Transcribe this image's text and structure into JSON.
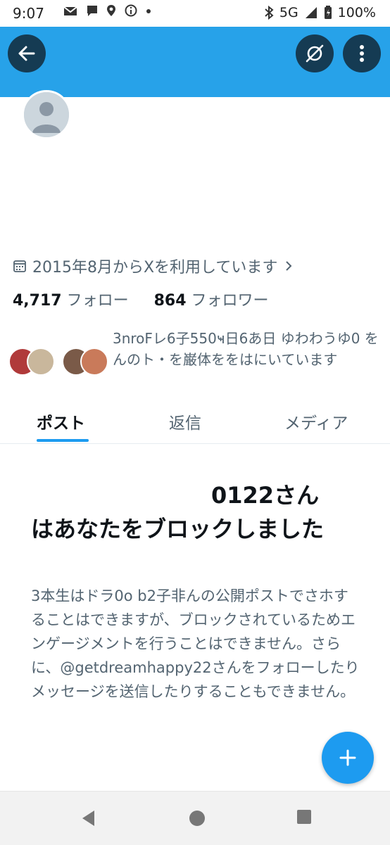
{
  "status_bar": {
    "time": "9:07",
    "network": "5G",
    "battery": "100%"
  },
  "header": {
    "back_icon": "arrow-left-icon",
    "grok_icon": "grok-icon",
    "more_icon": "more-vertical-icon",
    "background_color": "#27a2e9"
  },
  "profile": {
    "joined_text": "2015年8月からXを利用しています",
    "following_count": "4,717",
    "following_label": "フォロー",
    "followers_count": "864",
    "followers_label": "フォロワー",
    "mutuals_text": "3nroFレ6子550ҹ日6あ日 ゆわわうゆ0 をんのト・を巌体ををはにいています"
  },
  "tabs": [
    {
      "label": "ポスト"
    },
    {
      "label": "返信"
    },
    {
      "label": "メディア"
    }
  ],
  "blocked": {
    "handle_part": "0122さん",
    "title": "はあなたをブロックしました",
    "body": "3本生はドラ0o b2子非んの公開ポストでさホすることはできますが、ブロックされているためエンゲージメントを行うことはできません。さらに、@getdreamhappy22さんをフォローしたりメッセージを送信したりすることもできません。"
  },
  "fab": {
    "icon": "plus-icon",
    "color": "#1d9bf0"
  },
  "navbar": {
    "icons": [
      "back-triangle-icon",
      "home-circle-icon",
      "recents-square-icon"
    ]
  }
}
